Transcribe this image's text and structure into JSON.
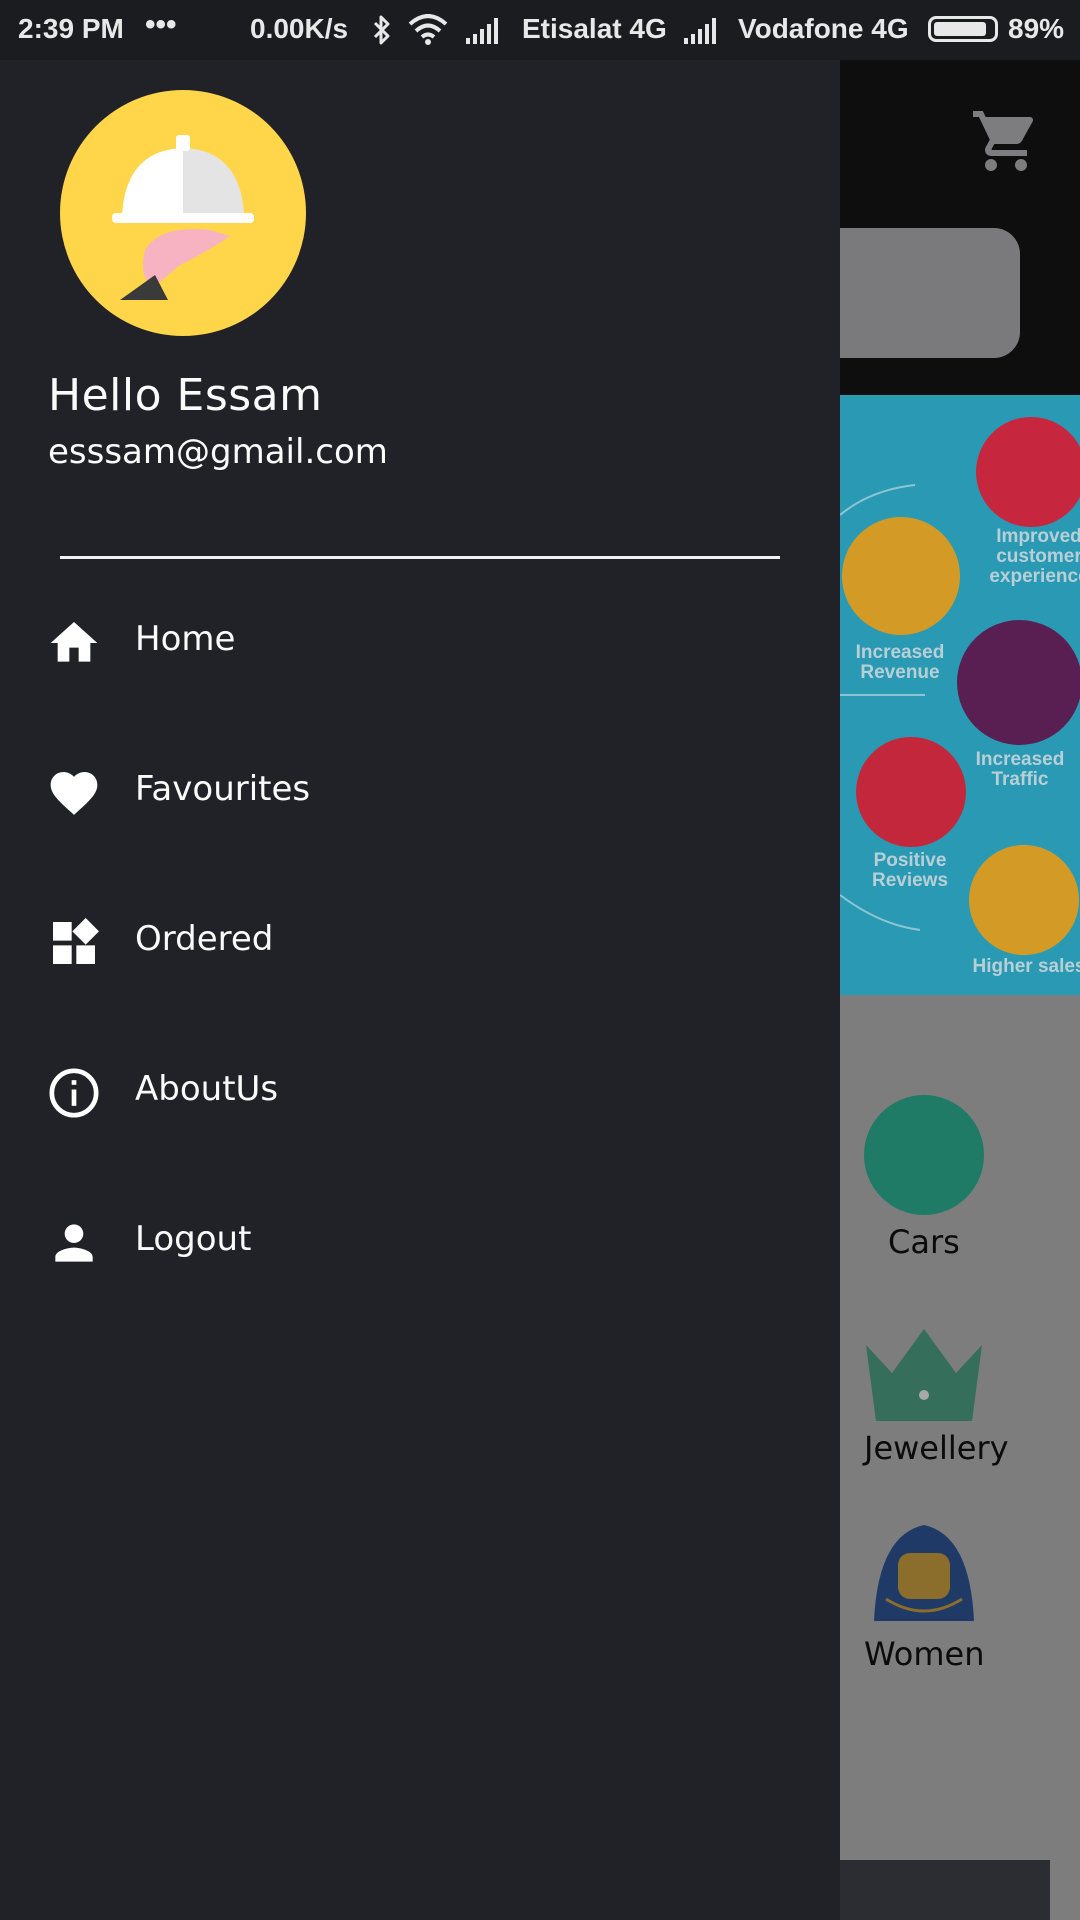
{
  "status_bar": {
    "time": "2:39 PM",
    "dots": "•••",
    "speed": "0.00K/s",
    "carrier1": "Etisalat 4G",
    "carrier2": "Vodafone 4G",
    "battery_pct": "89%",
    "battery_level": 0.89
  },
  "drawer": {
    "greeting": "Hello Essam",
    "email": "esssam@gmail.com",
    "menu": [
      {
        "label": "Home",
        "icon": "home-icon"
      },
      {
        "label": "Favourites",
        "icon": "heart-icon"
      },
      {
        "label": "Ordered",
        "icon": "dashboard-icon"
      },
      {
        "label": "AboutUs",
        "icon": "info-icon"
      },
      {
        "label": "Logout",
        "icon": "person-icon"
      }
    ]
  },
  "background": {
    "banner_labels": {
      "improved": "Improved\ncustomer\nexperience",
      "revenue": "Increased\nRevenue",
      "traffic": "Increased\nTraffic",
      "reviews": "Positive\nReviews",
      "sales": "Higher sales"
    },
    "categories": [
      {
        "label": "Cars"
      },
      {
        "label": "Jewellery"
      },
      {
        "label": "Women"
      }
    ]
  },
  "colors": {
    "drawer_bg": "#212227",
    "avatar_bg": "#ffd54a",
    "banner_bg": "#2a9ab4"
  }
}
